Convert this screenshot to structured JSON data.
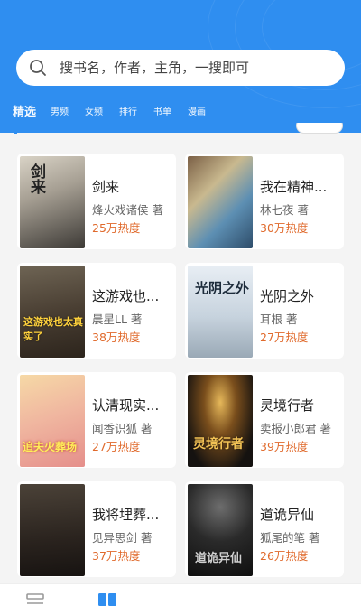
{
  "search": {
    "placeholder": "搜书名，作者，主角，一搜即可"
  },
  "tabs": [
    {
      "label": "精选",
      "active": true
    },
    {
      "label": "男频",
      "active": false
    },
    {
      "label": "女频",
      "active": false
    },
    {
      "label": "排行",
      "active": false
    },
    {
      "label": "书单",
      "active": false
    },
    {
      "label": "漫画",
      "active": false
    }
  ],
  "books": [
    {
      "title": "剑来",
      "author": "烽火戏诸侯 著",
      "heat": "25万热度",
      "cover_text": "剑来"
    },
    {
      "title": "我在精神...",
      "author": "林七夜 著",
      "heat": "30万热度",
      "cover_text": ""
    },
    {
      "title": "这游戏也...",
      "author": "晨星LL 著",
      "heat": "38万热度",
      "cover_text": "这游戏也太真实了"
    },
    {
      "title": "光阴之外",
      "author": "耳根 著",
      "heat": "27万热度",
      "cover_text": "光阴之外"
    },
    {
      "title": "认清现实...",
      "author": "闻香识狐 著",
      "heat": "27万热度",
      "cover_text": "追夫火葬场"
    },
    {
      "title": "灵境行者",
      "author": "卖报小郎君 著",
      "heat": "39万热度",
      "cover_text": "灵境行者"
    },
    {
      "title": "我将埋葬...",
      "author": "见异思剑 著",
      "heat": "37万热度",
      "cover_text": ""
    },
    {
      "title": "道诡异仙",
      "author": "狐尾的笔 著",
      "heat": "26万热度",
      "cover_text": "道诡异仙"
    }
  ],
  "colors": {
    "brand": "#2f8ef0",
    "heat": "#e06a2c"
  },
  "icons": {
    "search": "search-icon",
    "nav_left": "bookshelf-icon",
    "nav_right": "book-store-icon"
  }
}
